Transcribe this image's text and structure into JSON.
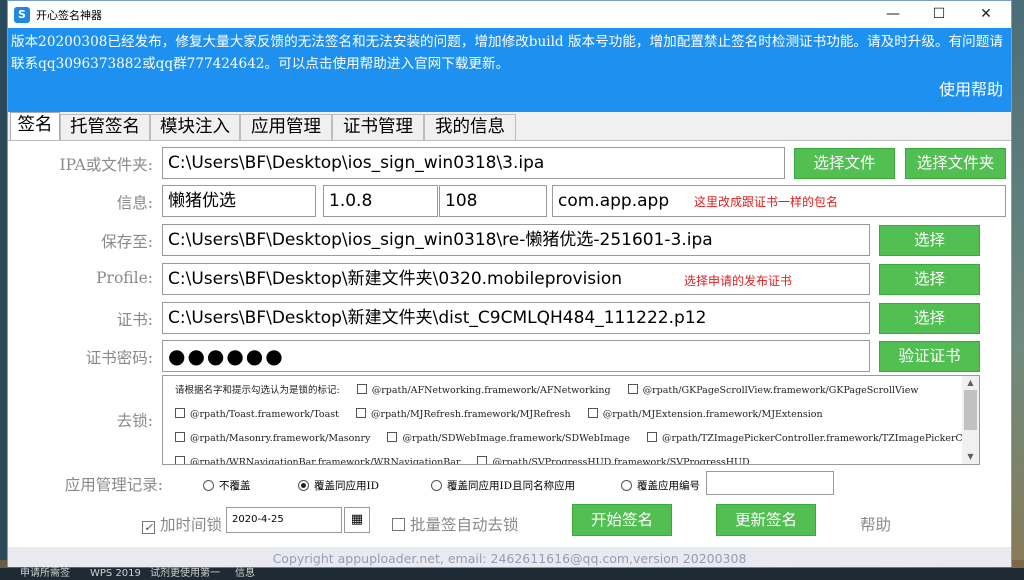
{
  "window": {
    "title": "开心签名神器",
    "minimize": "—",
    "maximize": "☐",
    "close": "✕"
  },
  "notice": {
    "text": "版本20200308已经发布，修复大量大家反馈的无法签名和无法安装的问题，增加修改build 版本号功能，增加配置禁止签名时检测证书功能。请及时升级。有问题请联系qq3096373882或qq群777424642。可以点击使用帮助进入官网下载更新。",
    "help_label": "使用帮助"
  },
  "tabs": [
    "签名",
    "托管签名",
    "模块注入",
    "应用管理",
    "证书管理",
    "我的信息"
  ],
  "form": {
    "ipa_label": "IPA或文件夹:",
    "ipa_value": "C:\\Users\\BF\\Desktop\\ios_sign_win0318\\3.ipa",
    "select_file": "选择文件",
    "select_folder": "选择文件夹",
    "info_label": "信息:",
    "app_name": "懒猪优选",
    "version": "1.0.8",
    "build": "108",
    "bundle_id": "com.app.app",
    "bundle_note": "这里改成跟证书一样的包名",
    "save_label": "保存至:",
    "save_value": "C:\\Users\\BF\\Desktop\\ios_sign_win0318\\re-懒猪优选-251601-3.ipa",
    "select": "选择",
    "profile_label": "Profile:",
    "profile_value": "C:\\Users\\BF\\Desktop\\新建文件夹\\0320.mobileprovision",
    "profile_note": "选择申请的发布证书",
    "cert_label": "证书:",
    "cert_value": "C:\\Users\\BF\\Desktop\\新建文件夹\\dist_C9CMLQH484_111222.p12",
    "pwd_label": "证书密码:",
    "pwd_value": "●●●●●●",
    "verify_cert": "验证证书",
    "lock_label": "去锁:",
    "lock_intro": "请根据名字和提示勾选认为是锁的标记:",
    "lock_items": [
      "@rpath/AFNetworking.framework/AFNetworking",
      "@rpath/GKPageScrollView.framework/GKPageScrollView",
      "@rpath/Toast.framework/Toast",
      "@rpath/MJRefresh.framework/MJRefresh",
      "@rpath/MJExtension.framework/MJExtension",
      "@rpath/Masonry.framework/Masonry",
      "@rpath/SDWebImage.framework/SDWebImage",
      "@rpath/TZImagePickerController.framework/TZImagePickerController",
      "@rpath/WRNavigationBar.framework/WRNavigationBar",
      "@rpath/SVProgressHUD.framework/SVProgressHUD"
    ],
    "record_label": "应用管理记录:",
    "radios": [
      "不覆盖",
      "覆盖同应用ID",
      "覆盖同应用ID且同名称应用",
      "覆盖应用编号"
    ],
    "timelock_label": "加时间锁",
    "date_value": "2020-4-25",
    "batch_label": "批量签自动去锁",
    "start_sign": "开始签名",
    "update_sign": "更新签名",
    "help": "帮助"
  },
  "footer": "Copyright appuploader.net, email: 2462611616@qq.com,version 20200308",
  "taskbar": [
    "申请所需签",
    "WPS 2019",
    "试剂更使用第一",
    "信息"
  ]
}
